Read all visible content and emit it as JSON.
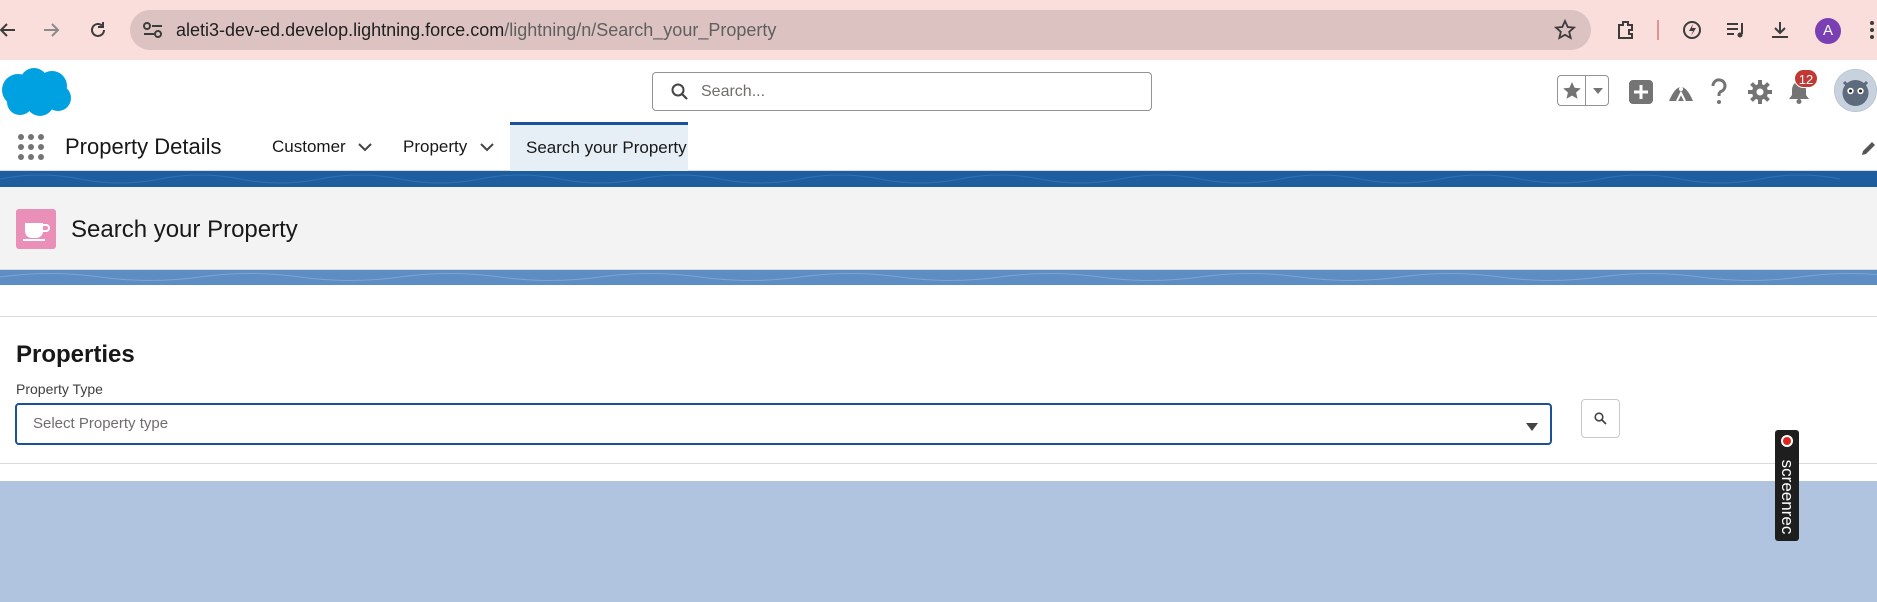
{
  "browser": {
    "url_host": "aleti3-dev-ed.develop.lightning.force.com",
    "url_path": "/lightning/n/Search_your_Property",
    "profile_initial": "A"
  },
  "header": {
    "search_placeholder": "Search...",
    "notification_count": "12"
  },
  "nav": {
    "app_name": "Property Details",
    "tabs": [
      {
        "label": "Customer"
      },
      {
        "label": "Property"
      },
      {
        "label": "Search your Property"
      }
    ]
  },
  "page": {
    "title": "Search your Property"
  },
  "card": {
    "title": "Properties",
    "field_label": "Property Type",
    "select_placeholder": "Select Property type"
  },
  "overlay": {
    "screenrec_label": "screenrec"
  },
  "colors": {
    "brand_blue": "#1e5d9e",
    "focus_border": "#1b5297",
    "page_icon": "#ea8fb8",
    "notification_badge": "#c23934"
  }
}
